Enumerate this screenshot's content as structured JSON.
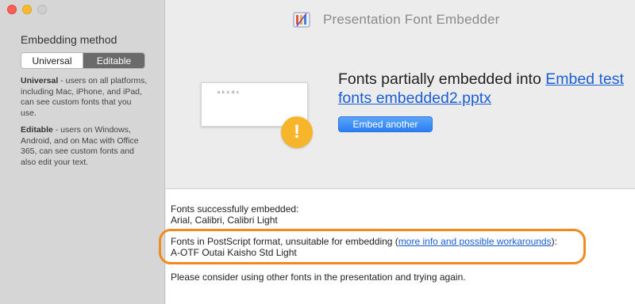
{
  "window": {
    "title": "Presentation Font Embedder"
  },
  "sidebar": {
    "method_label": "Embedding method",
    "segments": {
      "universal": "Universal",
      "editable": "Editable",
      "selected": "Editable"
    },
    "universal_desc": {
      "title": "Universal",
      "body": " - users on all platforms, including Mac, iPhone, and iPad, can see custom fonts that you use."
    },
    "editable_desc": {
      "title": "Editable",
      "body": " - users on Windows, Android, and on Mac with Office 365, can see custom fonts and also edit your text."
    }
  },
  "main": {
    "slide_preview_text": "a k s d s",
    "warning_glyph": "!",
    "status_prefix": "Fonts partially embedded into ",
    "file_link": "Embed test fonts embedded2.pptx",
    "embed_another_label": "Embed another"
  },
  "results": {
    "embedded_heading": "Fonts successfully embedded:",
    "embedded_fonts": "Arial, Calibri, Calibri Light",
    "postscript_prefix": "Fonts in PostScript format, unsuitable for embedding (",
    "postscript_link": "more info and possible workarounds",
    "postscript_suffix": "):",
    "postscript_fonts": "A-OTF Outai Kaisho Std Light",
    "footer_note": "Please consider using other fonts in the presentation and trying again."
  },
  "colors": {
    "accent_blue": "#2b7ef4",
    "link_blue": "#1a5ed6",
    "warning_yellow": "#f6b52a",
    "highlight_orange": "#f28a20",
    "sidebar_bg": "#d6d6d6",
    "selected_segment": "#6a6a6a"
  },
  "icons": {
    "app": "presentation-embedder-icon",
    "warning": "warning-icon"
  }
}
